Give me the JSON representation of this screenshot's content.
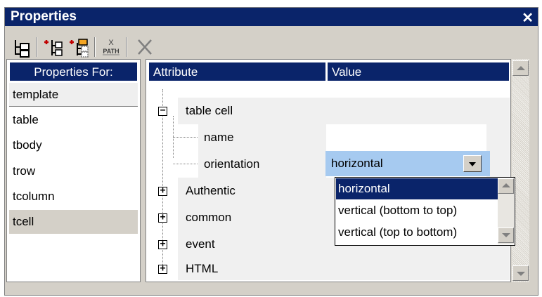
{
  "window": {
    "title": "Properties",
    "close_glyph": "✕"
  },
  "toolbar": {
    "icons": [
      "tree-layout-icon",
      "insert-element-icon",
      "append-element-icon",
      "xpath-icon",
      "delete-icon"
    ],
    "xpath_label": "PATH",
    "xpath_x": "X"
  },
  "left_panel": {
    "header": "Properties For:",
    "items": [
      "template",
      "table",
      "tbody",
      "trow",
      "tcolumn",
      "tcell"
    ],
    "selected": "tcell"
  },
  "grid": {
    "col_attribute": "Attribute",
    "col_value": "Value",
    "rows": [
      {
        "label": "table cell",
        "expander": "−",
        "value": ""
      },
      {
        "label": "name",
        "expander": "",
        "value": ""
      },
      {
        "label": "orientation",
        "expander": "",
        "value": "horizontal"
      },
      {
        "label": "Authentic",
        "expander": "+",
        "value": ""
      },
      {
        "label": "common",
        "expander": "+",
        "value": ""
      },
      {
        "label": "event",
        "expander": "+",
        "value": ""
      },
      {
        "label": "HTML",
        "expander": "+",
        "value": ""
      }
    ]
  },
  "dropdown": {
    "selected_value": "horizontal",
    "options": [
      "horizontal",
      "vertical (bottom to top)",
      "vertical (top to bottom)"
    ],
    "highlighted": "horizontal"
  },
  "colors": {
    "title_bar": "#0a246a",
    "selection": "#a6caf0",
    "face": "#d4d0c8"
  }
}
